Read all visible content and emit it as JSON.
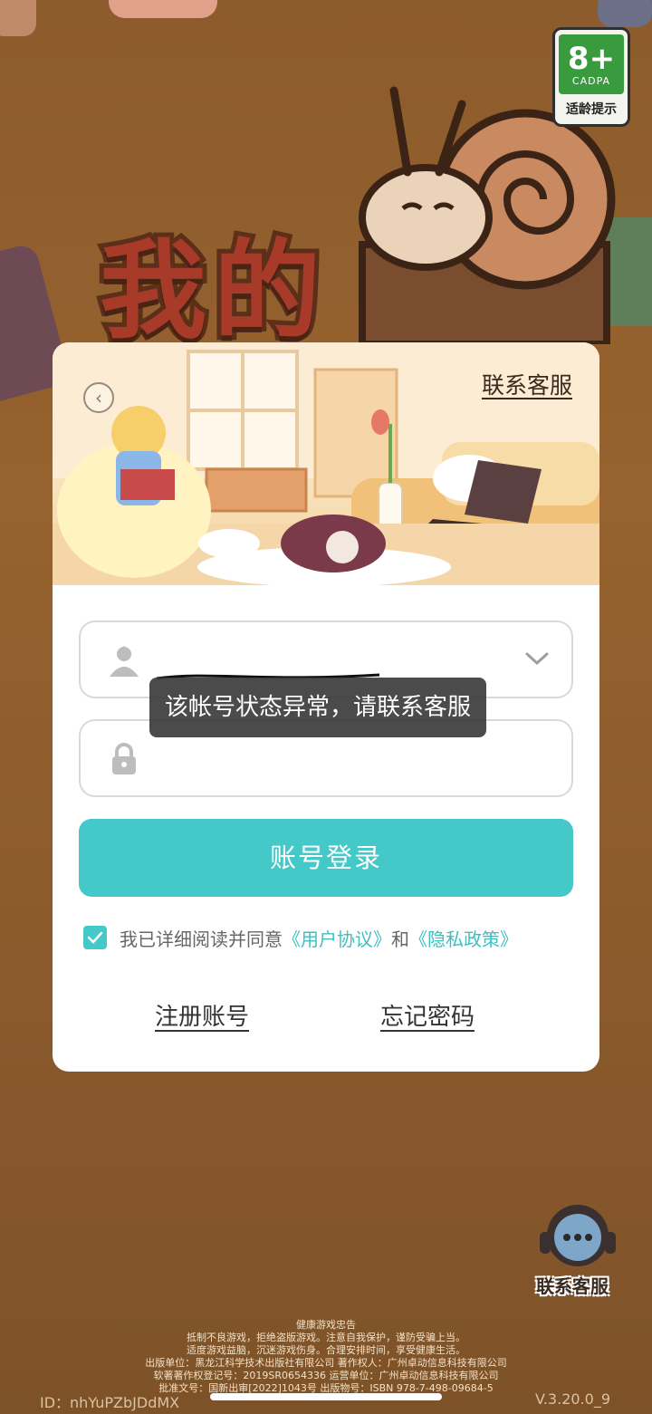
{
  "age_badge": {
    "rating": "8+",
    "org": "CADPA",
    "tip": "适龄提示"
  },
  "background": {
    "title": "我的"
  },
  "dialog": {
    "contact_service": "联系客服",
    "username": {
      "value": ""
    },
    "toast": "该帐号状态异常，请联系客服",
    "login_button": "账号登录",
    "agreement": {
      "prefix": "我已详细阅读并同意",
      "user_agreement": "《用户协议》",
      "and": "和",
      "privacy_policy": "《隐私政策》"
    },
    "register": "注册账号",
    "forgot_password": "忘记密码"
  },
  "float_service": {
    "label": "联系客服"
  },
  "footer": {
    "lines": [
      "健康游戏忠告",
      "抵制不良游戏，拒绝盗版游戏。注意自我保护，谨防受骗上当。",
      "适度游戏益脑，沉迷游戏伤身。合理安排时间，享受健康生活。",
      "出版单位：黑龙江科学技术出版社有限公司   著作权人：广州卓动信息科技有限公司",
      "软著著作权登记号：2019SR0654336   运营单位：广州卓动信息科技有限公司",
      "批准文号：国新出审[2022]1043号   出版物号：ISBN 978-7-498-09684-5"
    ],
    "id": "ID：nhYuPZbJDdMX",
    "version": "V.3.20.0_9"
  },
  "colors": {
    "accent": "#44c8c8",
    "link": "#3fbfbf",
    "toast_bg": "#3c3c3c"
  },
  "icons": [
    "back-arrow-icon",
    "user-icon",
    "lock-icon",
    "chevron-down-icon",
    "check-icon",
    "headset-icon"
  ]
}
